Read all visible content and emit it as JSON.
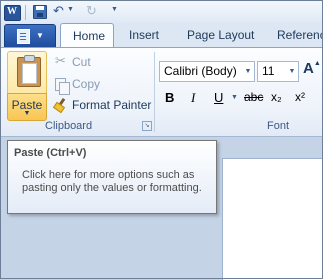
{
  "qat": {
    "app_icon": "word-icon",
    "save_icon": "save-icon",
    "undo_icon": "undo-icon",
    "redo_icon": "redo-icon",
    "customize_icon": "chevron-down-icon"
  },
  "tabs": {
    "file_icon": "document-menu-icon",
    "items": [
      "Home",
      "Insert",
      "Page Layout",
      "Reference"
    ]
  },
  "clipboard": {
    "paste_label": "Paste",
    "cut_label": "Cut",
    "copy_label": "Copy",
    "format_painter_label": "Format Painter",
    "group_label": "Clipboard"
  },
  "font": {
    "family": "Calibri (Body)",
    "size": "11",
    "grow_label": "A",
    "bold": "B",
    "italic": "I",
    "underline": "U",
    "strikethrough": "abc",
    "subscript": "x₂",
    "superscript": "x²",
    "group_label": "Font"
  },
  "tooltip": {
    "title": "Paste (Ctrl+V)",
    "body": "Click here for more options such as pasting only the values or formatting."
  },
  "colors": {
    "file_tab": "#2a5699",
    "ribbon_bg": "#eef3fa",
    "paste_highlight": "#f8c653",
    "tooltip_border": "#767676"
  }
}
